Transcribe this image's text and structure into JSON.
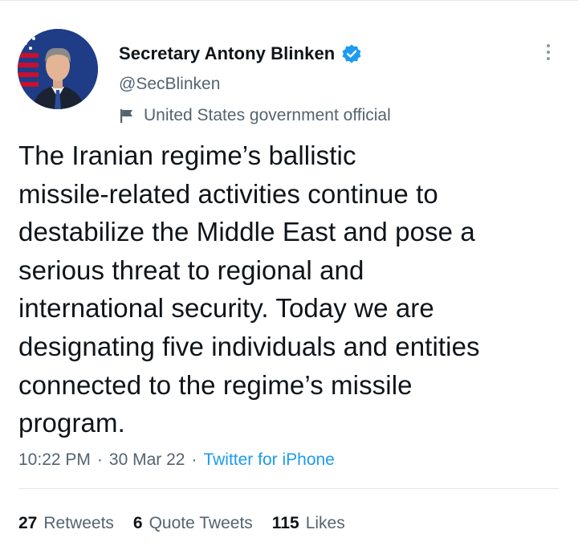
{
  "author": {
    "display_name": "Secretary Antony Blinken",
    "handle": "@SecBlinken",
    "label": "United States government official",
    "verified": true
  },
  "tweet": {
    "text": "The Iranian regime’s ballistic\nmissile-related activities continue to\ndestabilize the Middle East and pose a\nserious threat to regional and\ninternational security. Today we are\ndesignating five individuals and entities\nconnected to the regime’s missile\nprogram.",
    "time": "10:22 PM",
    "separator": "·",
    "date": "30 Mar 22",
    "source": "Twitter for iPhone"
  },
  "stats": {
    "retweets_count": "27",
    "retweets_label": "Retweets",
    "quotes_count": "6",
    "quotes_label": "Quote Tweets",
    "likes_count": "115",
    "likes_label": "Likes"
  },
  "colors": {
    "text_primary": "#0f1419",
    "text_secondary": "#536471",
    "accent": "#1d9bf0",
    "divider": "#e6e6e6"
  },
  "icons": {
    "verified": "verified-badge-icon",
    "label": "flag-icon",
    "more": "more-options-icon"
  }
}
